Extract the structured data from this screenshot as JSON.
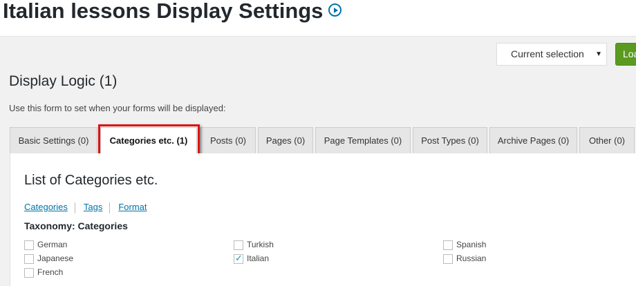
{
  "header": {
    "title": "Italian lessons Display Settings"
  },
  "toolbar": {
    "selection_value": "Current selection",
    "load_label": "Load"
  },
  "section": {
    "title": "Display Logic (1)",
    "description": "Use this form to set when your forms will be displayed:"
  },
  "tabs": [
    {
      "label": "Basic Settings (0)",
      "active": false
    },
    {
      "label": "Categories etc. (1)",
      "active": true
    },
    {
      "label": "Posts (0)",
      "active": false
    },
    {
      "label": "Pages (0)",
      "active": false
    },
    {
      "label": "Page Templates (0)",
      "active": false
    },
    {
      "label": "Post Types (0)",
      "active": false
    },
    {
      "label": "Archive Pages (0)",
      "active": false
    },
    {
      "label": "Other (0)",
      "active": false
    }
  ],
  "panel": {
    "title": "List of Categories etc.",
    "subnav": [
      "Categories",
      "Tags",
      "Format"
    ],
    "taxonomy_title": "Taxonomy: Categories",
    "categories": [
      {
        "label": "German",
        "checked": false
      },
      {
        "label": "Turkish",
        "checked": false
      },
      {
        "label": "Spanish",
        "checked": false
      },
      {
        "label": "Japanese",
        "checked": false
      },
      {
        "label": "Italian",
        "checked": true
      },
      {
        "label": "Russian",
        "checked": false
      },
      {
        "label": "French",
        "checked": false
      }
    ]
  },
  "colors": {
    "accent": "#0073aa",
    "button_green": "#5b9a20",
    "highlight_red": "#dd1111"
  },
  "icons": {
    "title_icon": "play-circle-icon",
    "select_icon": "chevron-down-icon",
    "check_icon": "check-icon"
  }
}
